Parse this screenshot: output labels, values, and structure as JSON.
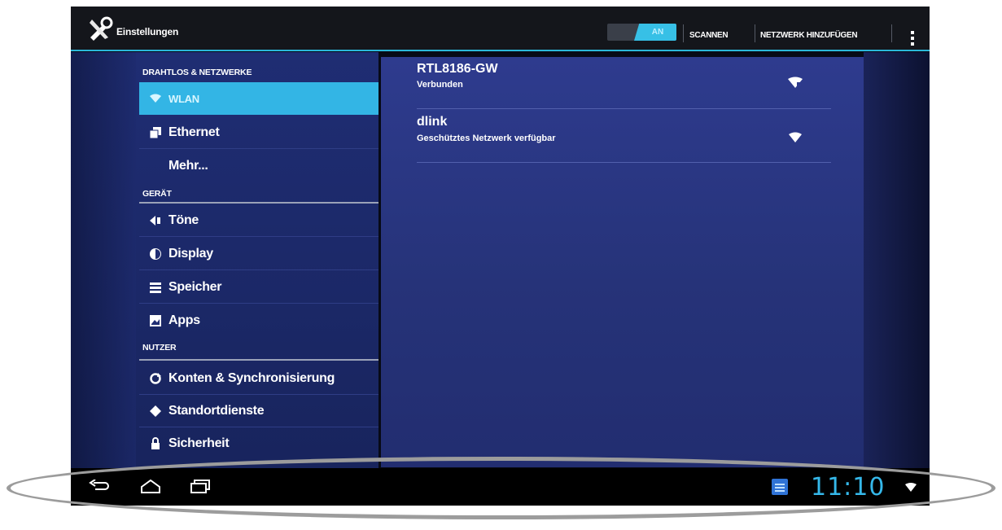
{
  "app": {
    "title": "Einstellungen",
    "icon": "settings-tools-icon"
  },
  "actionbar": {
    "wifi_toggle_label": "AN",
    "scan_label": "SCANNEN",
    "add_network_label": "NETZWERK HINZUFÜGEN",
    "overflow_icon": "overflow-menu-icon"
  },
  "sidebar": {
    "sections": [
      {
        "header": "DRAHTLOS & NETZWERKE",
        "items": [
          {
            "label": "WLAN",
            "icon": "wifi-icon",
            "selected": true
          },
          {
            "label": "Ethernet",
            "icon": "ethernet-icon"
          },
          {
            "label": "Mehr...",
            "icon": ""
          }
        ]
      },
      {
        "header": "GERÄT",
        "items": [
          {
            "label": "Töne",
            "icon": "speaker-icon"
          },
          {
            "label": "Display",
            "icon": "display-icon"
          },
          {
            "label": "Speicher",
            "icon": "storage-icon"
          },
          {
            "label": "Apps",
            "icon": "apps-icon"
          }
        ]
      },
      {
        "header": "NUTZER",
        "items": [
          {
            "label": "Konten & Synchronisierung",
            "icon": "sync-icon"
          },
          {
            "label": "Standortdienste",
            "icon": "location-icon"
          },
          {
            "label": "Sicherheit",
            "icon": "lock-icon"
          }
        ]
      }
    ]
  },
  "networks": [
    {
      "ssid": "RTL8186-GW",
      "status": "Verbunden",
      "icon": "wifi-signal-icon"
    },
    {
      "ssid": "dlink",
      "status": "Geschütztes Netzwerk verfügbar",
      "icon": "wifi-signal-locked-icon"
    }
  ],
  "systembar": {
    "back_icon": "back-icon",
    "home_icon": "home-icon",
    "recents_icon": "recent-apps-icon",
    "notification_icon": "notification-icon",
    "clock": "11:10",
    "status_icon": "wifi-status-icon"
  },
  "colors": {
    "accent": "#33b5e5",
    "list_bg": "#1f2d73",
    "content_bg": "#2e3b8e",
    "systembar_bg": "#000000"
  }
}
